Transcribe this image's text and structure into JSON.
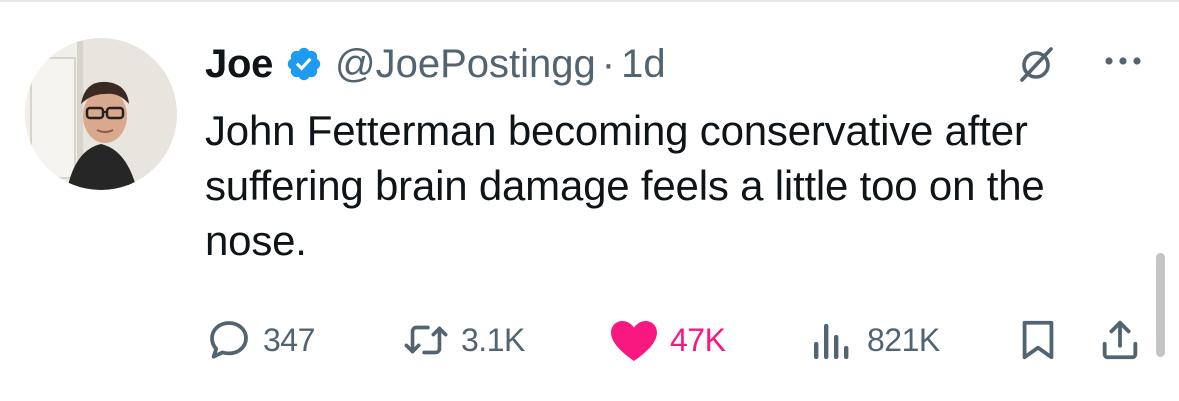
{
  "author": {
    "name": "Joe",
    "handle": "@JoePostingg",
    "separator": "·",
    "time": "1d"
  },
  "tweet": {
    "text": "John Fetterman becoming conservative after suffering brain damage feels a little too on the nose."
  },
  "actions": {
    "replies": "347",
    "retweets": "3.1K",
    "likes": "47K",
    "views": "821K"
  },
  "colors": {
    "verified": "#1d9bf0",
    "like": "#f91880",
    "muted": "#536471",
    "text": "#0f1419"
  },
  "icons": [
    "verified-badge-icon",
    "grok-icon",
    "more-icon",
    "reply-icon",
    "retweet-icon",
    "heart-icon",
    "views-icon",
    "bookmark-icon",
    "share-icon"
  ]
}
